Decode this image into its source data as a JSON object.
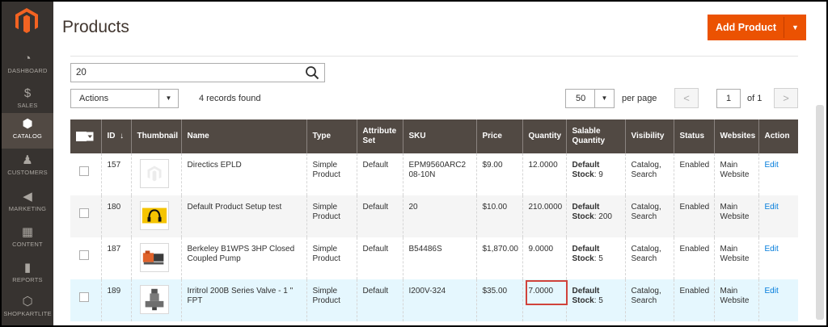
{
  "colors": {
    "sidebar_bg": "#373330",
    "header_bg": "#514943",
    "accent": "#eb5202",
    "link": "#007bdb",
    "highlight_row": "#e5f7fe",
    "highlight_border": "#d0433b"
  },
  "sidebar": {
    "logo_icon": "magento-logo-icon",
    "items": [
      {
        "label": "DASHBOARD",
        "icon": "dashboard-icon",
        "glyph": "◔"
      },
      {
        "label": "SALES",
        "icon": "dollar-icon",
        "glyph": "$"
      },
      {
        "label": "CATALOG",
        "icon": "cube-icon",
        "glyph": "⬢",
        "active": true
      },
      {
        "label": "CUSTOMERS",
        "icon": "person-icon",
        "glyph": "♟"
      },
      {
        "label": "MARKETING",
        "icon": "megaphone-icon",
        "glyph": "◀"
      },
      {
        "label": "CONTENT",
        "icon": "layout-icon",
        "glyph": "▦"
      },
      {
        "label": "REPORTS",
        "icon": "bar-chart-icon",
        "glyph": "▮"
      },
      {
        "label": "SHOPKARTLITE",
        "icon": "hexagon-icon",
        "glyph": "⬡"
      }
    ]
  },
  "header": {
    "title": "Products",
    "add_button_label": "Add Product",
    "add_button_arrow": "▼"
  },
  "search": {
    "value": "20"
  },
  "toolbar": {
    "actions_label": "Actions",
    "actions_arrow": "▼",
    "records_found": "4 records found",
    "per_page_value": "50",
    "per_page_arrow": "▼",
    "per_page_label": "per page",
    "prev_glyph": "<",
    "next_glyph": ">",
    "current_page": "1",
    "page_of": "of 1"
  },
  "table": {
    "headers": {
      "id": "ID",
      "id_sort": "↓",
      "thumbnail": "Thumbnail",
      "name": "Name",
      "type": "Type",
      "attribute_set": "Attribute Set",
      "sku": "SKU",
      "price": "Price",
      "quantity": "Quantity",
      "salable_quantity": "Salable Quantity",
      "visibility": "Visibility",
      "status": "Status",
      "websites": "Websites",
      "action": "Action"
    },
    "rows": [
      {
        "id": "157",
        "thumbnail": "placeholder-thumb-icon",
        "name": "Directics EPLD",
        "type": "Simple Product",
        "attribute_set": "Default",
        "sku": "EPM9560ARC208-10N",
        "price": "$9.00",
        "quantity": "12.0000",
        "stock_label": "Default Stock",
        "stock_value": ": 9",
        "visibility": "Catalog, Search",
        "status": "Enabled",
        "websites": "Main Website",
        "action": "Edit"
      },
      {
        "id": "180",
        "thumbnail": "headphones-thumb-icon",
        "name": "Default Product Setup test",
        "type": "Simple Product",
        "attribute_set": "Default",
        "sku": "20",
        "price": "$10.00",
        "quantity": "210.0000",
        "stock_label": "Default Stock",
        "stock_value": ": 200",
        "visibility": "Catalog, Search",
        "status": "Enabled",
        "websites": "Main Website",
        "action": "Edit"
      },
      {
        "id": "187",
        "thumbnail": "pump-thumb-icon",
        "name": "Berkeley B1WPS 3HP Closed Coupled Pump",
        "type": "Simple Product",
        "attribute_set": "Default",
        "sku": "B54486S",
        "price": "$1,870.00",
        "quantity": "9.0000",
        "stock_label": "Default Stock",
        "stock_value": ": 5",
        "visibility": "Catalog, Search",
        "status": "Enabled",
        "websites": "Main Website",
        "action": "Edit"
      },
      {
        "id": "189",
        "thumbnail": "valve-thumb-icon",
        "name": "Irritrol 200B Series Valve - 1 \" FPT",
        "type": "Simple Product",
        "attribute_set": "Default",
        "sku": "I200V-324",
        "price": "$35.00",
        "quantity": "7.0000",
        "stock_label": "Default Stock",
        "stock_value": ": 5",
        "visibility": "Catalog, Search",
        "status": "Enabled",
        "websites": "Main Website",
        "action": "Edit"
      }
    ]
  }
}
